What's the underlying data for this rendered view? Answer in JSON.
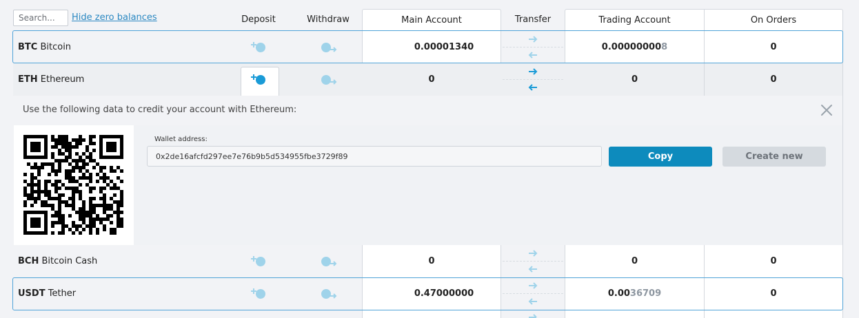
{
  "search": {
    "placeholder": "Search..."
  },
  "hide_zero_label": "Hide zero balances",
  "columns": {
    "deposit": "Deposit",
    "withdraw": "Withdraw",
    "main_account": "Main Account",
    "transfer": "Transfer",
    "trading_account": "Trading Account",
    "on_orders": "On Orders"
  },
  "rows": [
    {
      "symbol": "BTC",
      "name": "Bitcoin",
      "main": "0.00001340",
      "trading_main": "0.00000000",
      "trading_dim": "8",
      "orders": "0"
    },
    {
      "symbol": "ETH",
      "name": "Ethereum",
      "main": "0",
      "trading_main": "0",
      "trading_dim": "",
      "orders": "0"
    },
    {
      "symbol": "BCH",
      "name": "Bitcoin Cash",
      "main": "0",
      "trading_main": "0",
      "trading_dim": "",
      "orders": "0"
    },
    {
      "symbol": "USDT",
      "name": "Tether",
      "main": "0.47000000",
      "trading_main": "0.00",
      "trading_dim": "36709",
      "orders": "0"
    }
  ],
  "deposit_panel": {
    "title": "Use the following data to credit your account with Ethereum:",
    "wallet_label": "Wallet address:",
    "wallet_address": "0x2de16afcfd297ee7e76b9b5d534955fbe3729f89",
    "copy_label": "Copy",
    "create_new_label": "Create new"
  },
  "colors": {
    "accent": "#0d8bbd",
    "frame": "#4fa3d8",
    "icon": "#9fd3ea",
    "icon_active": "#1a9bd7"
  }
}
